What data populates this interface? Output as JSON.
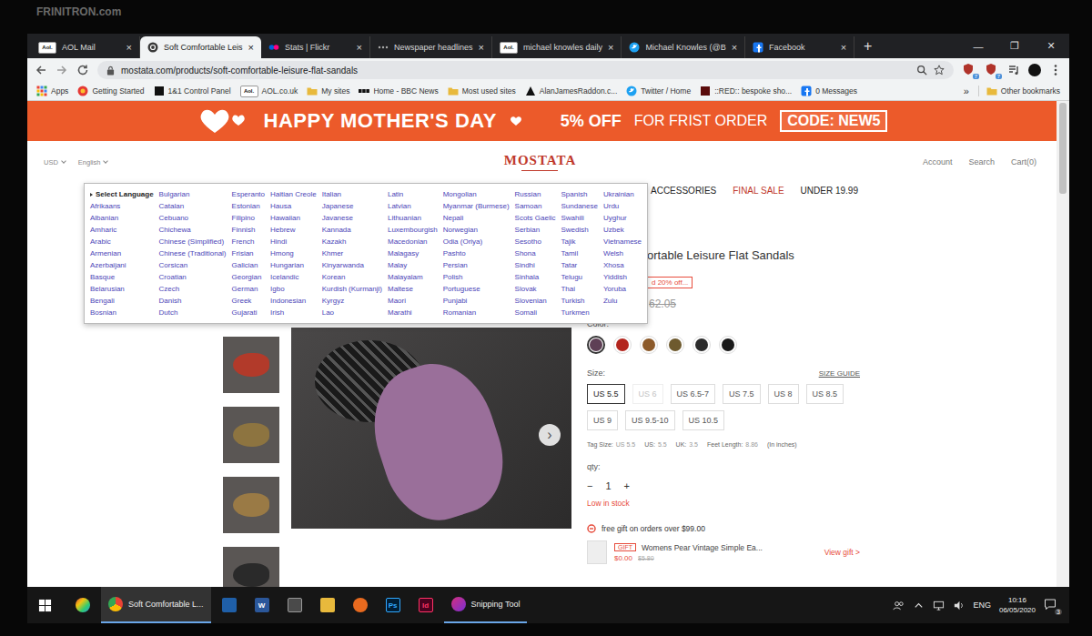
{
  "frame": {
    "label": "FRINITRON.com"
  },
  "browser": {
    "tabs": [
      {
        "label": "AOL Mail",
        "selected": false,
        "icon": "aol",
        "icon_text": "Aol."
      },
      {
        "label": "Soft Comfortable Leis",
        "selected": true,
        "icon": "site"
      },
      {
        "label": "Stats | Flickr",
        "selected": false,
        "icon": "flickr"
      },
      {
        "label": "Newspaper headlines",
        "selected": false,
        "icon": "dots"
      },
      {
        "label": "michael knowles daily",
        "selected": false,
        "icon": "aol",
        "icon_text": "Aol."
      },
      {
        "label": "Michael Knowles (@B",
        "selected": false,
        "icon": "twitter"
      },
      {
        "label": "Facebook",
        "selected": false,
        "icon": "facebook"
      }
    ],
    "tab_close": "×",
    "new_tab": "+",
    "window_controls": [
      "—",
      "❐",
      "✕"
    ],
    "address": "mostata.com/products/soft-comfortable-leisure-flat-sandals",
    "extensions": [
      {
        "badge": "7"
      },
      {
        "badge": "7"
      }
    ],
    "bookmarks": [
      {
        "label": "Apps",
        "icon": "apps"
      },
      {
        "label": "Getting Started",
        "icon": "chrome"
      },
      {
        "label": "1&1 Control Panel",
        "icon": "oneandone"
      },
      {
        "label": "AOL.co.uk",
        "icon": "aol",
        "icon_text": "Aol."
      },
      {
        "label": "My sites",
        "icon": "folder"
      },
      {
        "label": "Home - BBC News",
        "icon": "bbc"
      },
      {
        "label": "Most used sites",
        "icon": "folder"
      },
      {
        "label": "AlanJamesRaddon.c...",
        "icon": "raddon"
      },
      {
        "label": "Twitter / Home",
        "icon": "twitter"
      },
      {
        "label": "::RED:: bespoke sho...",
        "icon": "red"
      },
      {
        "label": "0 Messages",
        "icon": "facebook"
      }
    ],
    "bookmarks_overflow": "»",
    "other_bookmarks": "Other bookmarks"
  },
  "banner": {
    "title": "HAPPY MOTHER'S DAY",
    "offer": "5% OFF",
    "offer_note": "FOR FRIST ORDER",
    "code": "CODE: NEW5"
  },
  "header": {
    "currency": "USD",
    "language": "English",
    "logo": "MOSTATA",
    "links": [
      "Account",
      "Search",
      "Cart(0)"
    ]
  },
  "nav": [
    {
      "label": "ACCESSORIES",
      "sale": false
    },
    {
      "label": "FINAL SALE",
      "sale": true
    },
    {
      "label": "UNDER 19.99",
      "sale": false
    }
  ],
  "language_menu": {
    "title": "Select Language",
    "columns": [
      [
        "Afrikaans",
        "Albanian",
        "Amharic",
        "Arabic",
        "Armenian",
        "Azerbaijani",
        "Basque",
        "Belarusian",
        "Bengali",
        "Bosnian"
      ],
      [
        "Bulgarian",
        "Catalan",
        "Cebuano",
        "Chichewa",
        "Chinese (Simplified)",
        "Chinese (Traditional)",
        "Corsican",
        "Croatian",
        "Czech",
        "Danish",
        "Dutch"
      ],
      [
        "Esperanto",
        "Estonian",
        "Filipino",
        "Finnish",
        "French",
        "Frisian",
        "Galician",
        "Georgian",
        "German",
        "Greek",
        "Gujarati"
      ],
      [
        "Haitian Creole",
        "Hausa",
        "Hawaiian",
        "Hebrew",
        "Hindi",
        "Hmong",
        "Hungarian",
        "Icelandic",
        "Igbo",
        "Indonesian",
        "Irish"
      ],
      [
        "Italian",
        "Japanese",
        "Javanese",
        "Kannada",
        "Kazakh",
        "Khmer",
        "Kinyarwanda",
        "Korean",
        "Kurdish (Kurmanji)",
        "Kyrgyz",
        "Lao"
      ],
      [
        "Latin",
        "Latvian",
        "Lithuanian",
        "Luxembourgish",
        "Macedonian",
        "Malagasy",
        "Malay",
        "Malayalam",
        "Maltese",
        "Maori",
        "Marathi"
      ],
      [
        "Mongolian",
        "Myanmar (Burmese)",
        "Nepali",
        "Norwegian",
        "Odia (Oriya)",
        "Pashto",
        "Persian",
        "Polish",
        "Portuguese",
        "Punjabi",
        "Romanian"
      ],
      [
        "Russian",
        "Samoan",
        "Scots Gaelic",
        "Serbian",
        "Sesotho",
        "Shona",
        "Sindhi",
        "Sinhala",
        "Slovak",
        "Slovenian",
        "Somali"
      ],
      [
        "Spanish",
        "Sundanese",
        "Swahili",
        "Swedish",
        "Tajik",
        "Tamil",
        "Tatar",
        "Telugu",
        "Thai",
        "Turkish",
        "Turkmen"
      ],
      [
        "Ukrainian",
        "Urdu",
        "Uyghur",
        "Uzbek",
        "Vietnamese",
        "Welsh",
        "Xhosa",
        "Yiddish",
        "Yoruba",
        "Zulu"
      ]
    ]
  },
  "product": {
    "thumbnails": [
      {
        "color": "#b23a2a"
      },
      {
        "color": "#8d7440"
      },
      {
        "color": "#9a7a45"
      },
      {
        "color": "#2a2a2a"
      }
    ],
    "image_next": "›",
    "title": "ortable Leisure Flat Sandals",
    "discount": "d 20% off...",
    "old_price": "62.05",
    "color_label": "Color:",
    "colors": [
      {
        "color": "#5e3f55",
        "selected": true
      },
      {
        "color": "#b3261e",
        "selected": false
      },
      {
        "color": "#8c5a2a",
        "selected": false
      },
      {
        "color": "#6e5a2e",
        "selected": false
      },
      {
        "color": "#2b2b2b",
        "selected": false
      },
      {
        "color": "#1a1a1a",
        "selected": false
      }
    ],
    "size_label": "Size:",
    "size_guide": "SIZE GUIDE",
    "sizes": [
      {
        "label": "US 5.5",
        "selected": true,
        "disabled": false
      },
      {
        "label": "US 6",
        "selected": false,
        "disabled": true
      },
      {
        "label": "US 6.5-7",
        "selected": false,
        "disabled": false
      },
      {
        "label": "US 7.5",
        "selected": false,
        "disabled": false
      },
      {
        "label": "US 8",
        "selected": false,
        "disabled": false
      },
      {
        "label": "US 8.5",
        "selected": false,
        "disabled": false
      },
      {
        "label": "US 9",
        "selected": false,
        "disabled": false
      },
      {
        "label": "US 9.5-10",
        "selected": false,
        "disabled": false
      },
      {
        "label": "US 10.5",
        "selected": false,
        "disabled": false
      }
    ],
    "tag_size": [
      {
        "label": "Tag Size:",
        "value": "US 5.5"
      },
      {
        "label": "US:",
        "value": "5.5"
      },
      {
        "label": "UK:",
        "value": "3.5"
      },
      {
        "label": "Feet Length:",
        "value": "8.86"
      }
    ],
    "tag_note": "(In inches)",
    "qty_label": "qty:",
    "minus": "−",
    "qty": "1",
    "plus": "+",
    "stock": "Low in stock",
    "gift_note": "free gift on orders over $99.00",
    "gift": {
      "tag": "GIFT",
      "name": "Womens Pear Vintage Simple Ea...",
      "price": "$0.00",
      "old_price": "$5.80",
      "link": "View gift >"
    }
  },
  "taskbar": {
    "items": [
      {
        "kind": "app",
        "icon": "colorful",
        "selected": false
      },
      {
        "kind": "window",
        "icon": "chrome",
        "label": "Soft Comfortable L...",
        "selected": true
      },
      {
        "kind": "app",
        "icon": "photos",
        "selected": false
      },
      {
        "kind": "app",
        "icon": "word",
        "glyph": "W",
        "selected": false
      },
      {
        "kind": "app",
        "icon": "calc",
        "selected": false
      },
      {
        "kind": "app",
        "icon": "folder",
        "selected": false
      },
      {
        "kind": "app",
        "icon": "media",
        "selected": false
      },
      {
        "kind": "app",
        "icon": "ps",
        "glyph": "Ps",
        "selected": false
      },
      {
        "kind": "app",
        "icon": "id",
        "glyph": "Id",
        "selected": false
      },
      {
        "kind": "window",
        "icon": "snip",
        "label": "Snipping Tool",
        "selected": false
      }
    ],
    "tray": {
      "language": "ENG",
      "time": "10:16",
      "date": "06/05/2020",
      "notifications": "3"
    }
  }
}
